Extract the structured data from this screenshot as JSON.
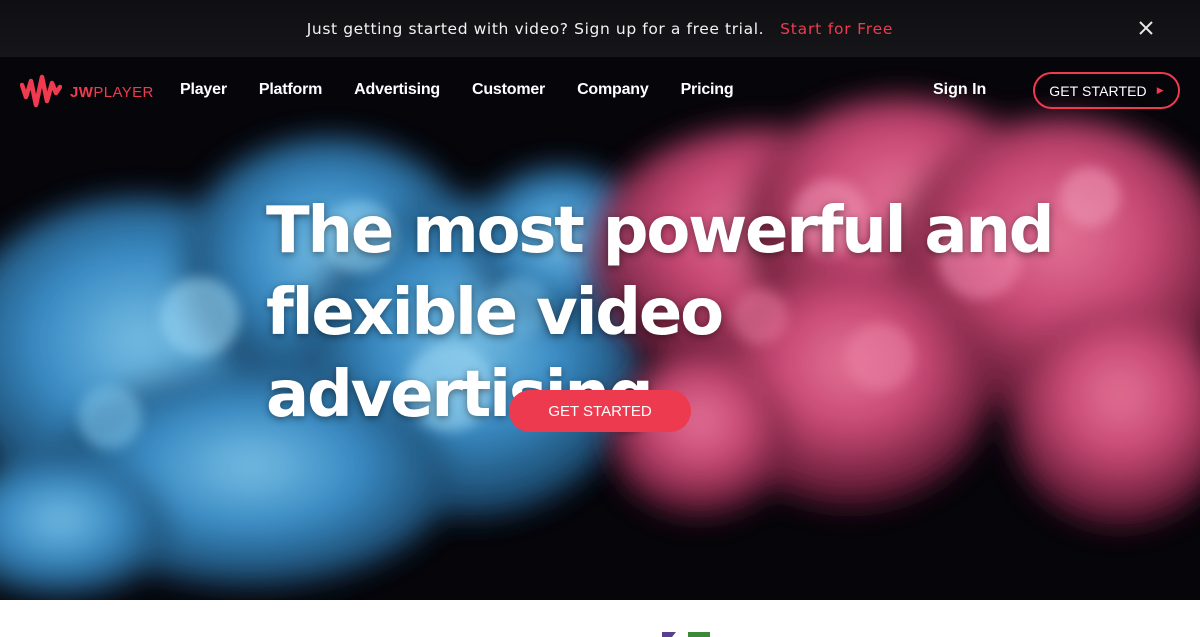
{
  "promo": {
    "text": "Just getting started with video? Sign up for a free trial.",
    "link": "Start for Free",
    "close_icon": "close-icon"
  },
  "nav": {
    "logo_bold": "JW",
    "logo_rest": "PLAYER",
    "links": [
      "Player",
      "Platform",
      "Advertising",
      "Customer",
      "Company",
      "Pricing"
    ],
    "sign_in": "Sign In",
    "cta": "GET STARTED",
    "cta_icon": "play-triangle-icon"
  },
  "hero": {
    "headline_line1": "The most powerful and",
    "headline_line2": "flexible video advertising",
    "cta": "GET STARTED"
  },
  "colors": {
    "brand_red": "#ef3a4f",
    "promo_bg": "#111114",
    "hero_bg": "#06050a"
  }
}
